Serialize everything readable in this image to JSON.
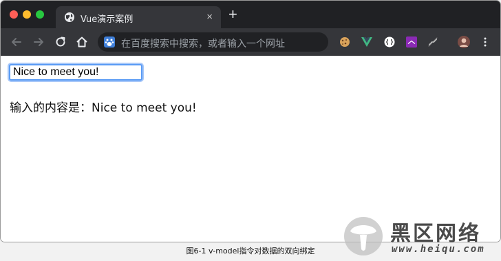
{
  "browser": {
    "tab_title": "Vue演示案例",
    "tab_close_glyph": "×",
    "new_tab_glyph": "+",
    "omnibox_placeholder": "在百度搜索中搜索，或者输入一个网址",
    "colors": {
      "tab_bar": "#202124",
      "toolbar": "#35363a",
      "close": "#ff5f57",
      "minimize": "#febc2e",
      "maximize": "#28c840"
    },
    "extensions": [
      "cookie-icon",
      "vue-devtools-icon",
      "json-icon",
      "rp-icon",
      "link-icon",
      "profile-avatar"
    ]
  },
  "page": {
    "input_value": "Nice to meet you!",
    "output_label": "输入的内容是：",
    "output_value": "Nice to meet you!"
  },
  "caption": "图6-1 v-model指令对数据的双向绑定",
  "watermark": {
    "text": "黑区网络",
    "url": "www.heiqu.com"
  }
}
